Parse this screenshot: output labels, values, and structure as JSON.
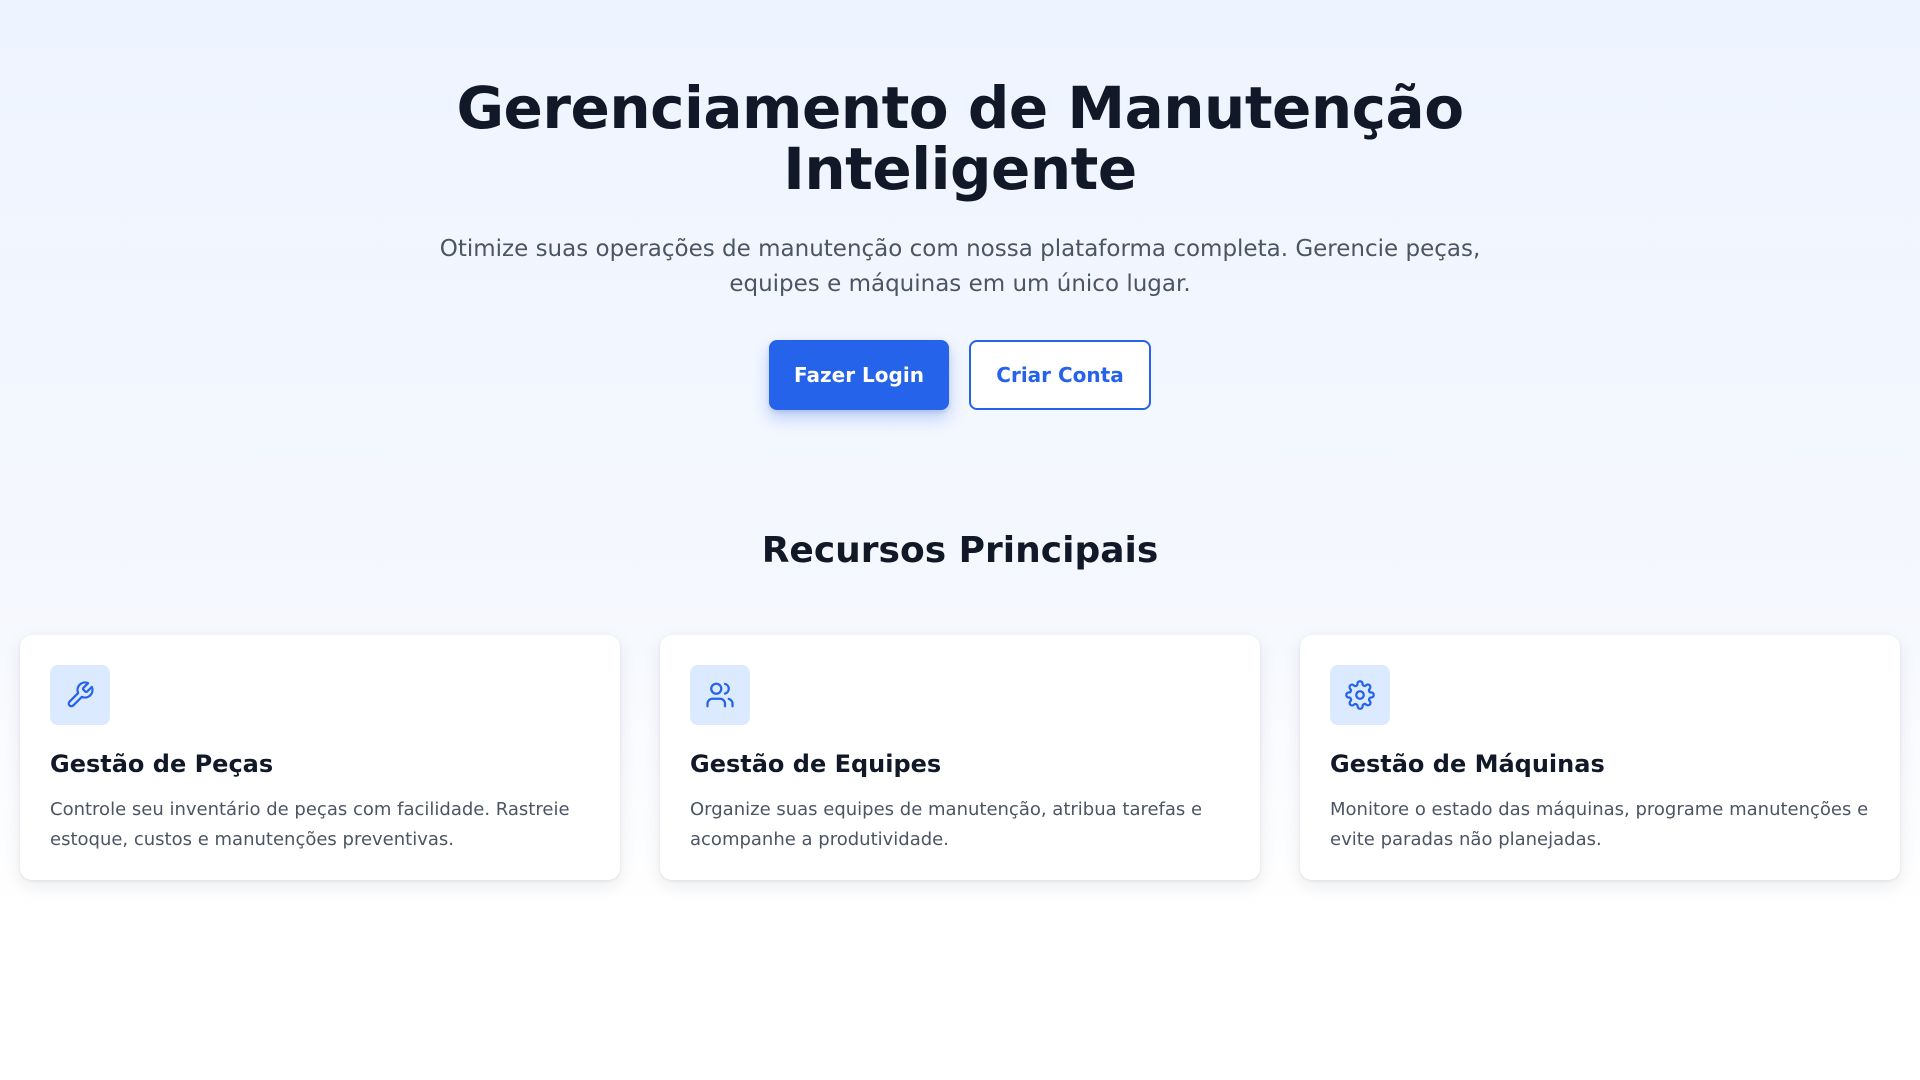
{
  "hero": {
    "title": "Gerenciamento de Manutenção Inteligente",
    "subtitle": "Otimize suas operações de manutenção com nossa plataforma completa. Gerencie peças, equipes e máquinas em um único lugar.",
    "login_button": "Fazer Login",
    "signup_button": "Criar Conta"
  },
  "features": {
    "title": "Recursos Principais",
    "cards": [
      {
        "icon": "wrench-icon",
        "title": "Gestão de Peças",
        "description": "Controle seu inventário de peças com facilidade. Rastreie estoque, custos e manutenções preventivas."
      },
      {
        "icon": "users-icon",
        "title": "Gestão de Equipes",
        "description": "Organize suas equipes de manutenção, atribua tarefas e acompanhe a produtividade."
      },
      {
        "icon": "gear-icon",
        "title": "Gestão de Máquinas",
        "description": "Monitore o estado das máquinas, programe manutenções e evite paradas não planejadas."
      }
    ]
  },
  "colors": {
    "primary": "#2563eb",
    "heading": "#111827",
    "body_text": "#4b5563",
    "icon_background": "#dbeafe",
    "page_gradient_top": "#eef4ff",
    "page_gradient_bottom": "#ffffff"
  }
}
